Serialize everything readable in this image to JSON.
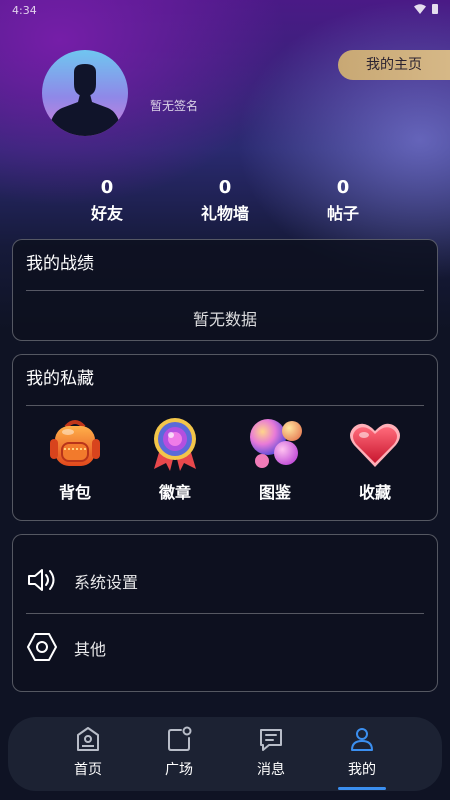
{
  "status_bar": {
    "time": "4:34"
  },
  "profile": {
    "signature": "暂无签名",
    "homepage_button": "我的主页"
  },
  "stats": [
    {
      "count": "0",
      "label": "好友"
    },
    {
      "count": "0",
      "label": "礼物墙"
    },
    {
      "count": "0",
      "label": "帖子"
    }
  ],
  "record": {
    "title": "我的战绩",
    "empty_text": "暂无数据"
  },
  "collection": {
    "title": "我的私藏",
    "items": [
      {
        "label": "背包",
        "icon": "backpack-icon"
      },
      {
        "label": "徽章",
        "icon": "badge-icon"
      },
      {
        "label": "图鉴",
        "icon": "bubbles-icon"
      },
      {
        "label": "收藏",
        "icon": "heart-icon"
      }
    ]
  },
  "settings": [
    {
      "label": "系统设置",
      "icon": "speaker-icon"
    },
    {
      "label": "其他",
      "icon": "hexagon-icon"
    }
  ],
  "nav": {
    "items": [
      {
        "label": "首页",
        "icon": "home-icon"
      },
      {
        "label": "广场",
        "icon": "square-icon"
      },
      {
        "label": "消息",
        "icon": "message-icon"
      },
      {
        "label": "我的",
        "icon": "user-icon"
      }
    ],
    "active": "我的",
    "active_color": "#3b8ff0"
  },
  "colors": {
    "homepage_button": "#d6b887",
    "background": "#0f1324"
  }
}
